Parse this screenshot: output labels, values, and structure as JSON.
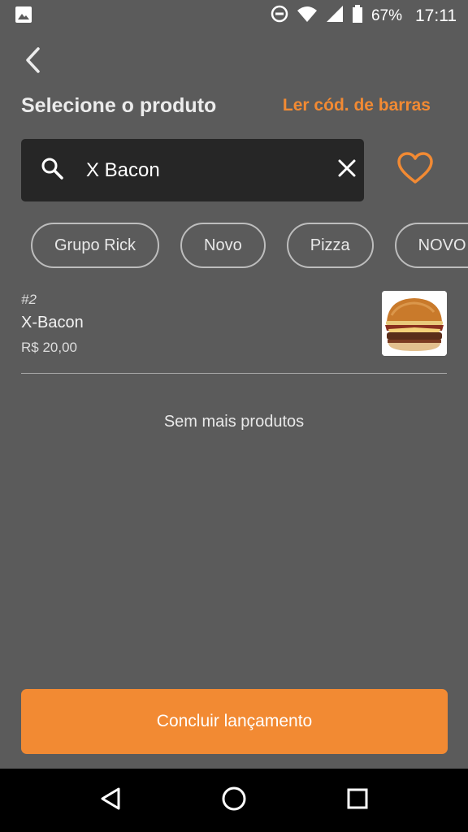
{
  "status_bar": {
    "battery": "67%",
    "time": "17:11"
  },
  "header": {
    "title": "Selecione o produto",
    "barcode_link": "Ler cód. de barras"
  },
  "search": {
    "value": "X Bacon"
  },
  "filters": [
    "Grupo Rick",
    "Novo",
    "Pizza",
    "NOVO"
  ],
  "products": [
    {
      "code": "#2",
      "name": "X-Bacon",
      "price": "R$ 20,00"
    }
  ],
  "end_message": "Sem mais produtos",
  "submit_label": "Concluir lançamento",
  "colors": {
    "background": "#5b5b5b",
    "accent": "#f28a33",
    "search_bg": "#262626"
  }
}
